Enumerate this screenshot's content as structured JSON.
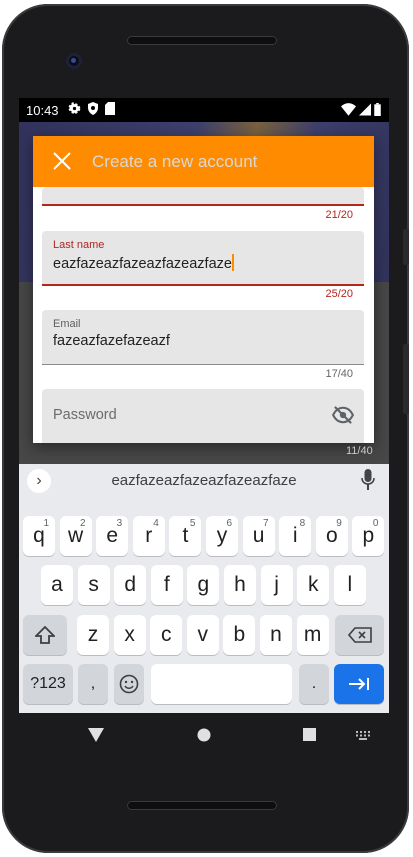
{
  "status_bar": {
    "time": "10:43"
  },
  "dialog": {
    "title": "Create a new account",
    "first_name_counter": "21/20",
    "last_name": {
      "label": "Last name",
      "value": "eazfazeazfazeazfazeazfaze",
      "counter": "25/20"
    },
    "email": {
      "label": "Email",
      "value": "fazeazfazefazeazf",
      "counter": "17/40"
    },
    "password": {
      "placeholder": "Password"
    }
  },
  "background_counter": "11/40",
  "keyboard": {
    "suggestion": "eazfazeazfazeazfazeazfaze",
    "row1": [
      {
        "k": "q",
        "n": "1"
      },
      {
        "k": "w",
        "n": "2"
      },
      {
        "k": "e",
        "n": "3"
      },
      {
        "k": "r",
        "n": "4"
      },
      {
        "k": "t",
        "n": "5"
      },
      {
        "k": "y",
        "n": "6"
      },
      {
        "k": "u",
        "n": "7"
      },
      {
        "k": "i",
        "n": "8"
      },
      {
        "k": "o",
        "n": "9"
      },
      {
        "k": "p",
        "n": "0"
      }
    ],
    "row2": [
      "a",
      "s",
      "d",
      "f",
      "g",
      "h",
      "j",
      "k",
      "l"
    ],
    "row3": [
      "z",
      "x",
      "c",
      "v",
      "b",
      "n",
      "m"
    ],
    "symbols_label": "?123",
    "comma": ",",
    "period": "."
  }
}
